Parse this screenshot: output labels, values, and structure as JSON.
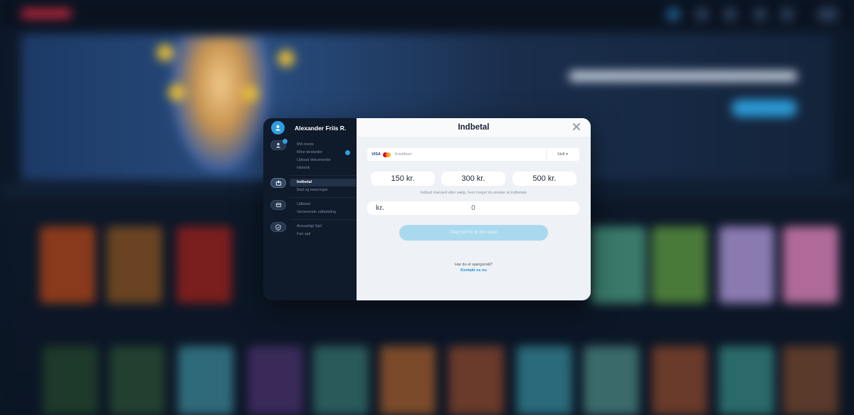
{
  "colors": {
    "accent": "#2d9fe0",
    "sidebar_bg": "#0f1a2b",
    "modal_bg": "#eef1f5",
    "submit_disabled": "#a9d9ef",
    "link": "#1f8fd1"
  },
  "sidebar": {
    "user_name": "Alexander Friis R.",
    "avatar_icon": "user-icon",
    "groups": [
      {
        "icon": "profile-icon",
        "items": [
          {
            "label": "Min konto"
          },
          {
            "label": "Mine beskeder",
            "badge": true
          },
          {
            "label": "Upload dokumenter"
          },
          {
            "label": "Historik"
          }
        ]
      },
      {
        "icon": "deposit-icon",
        "items": [
          {
            "label": "Indbetal",
            "active": true
          },
          {
            "label": "Bad og belønnger"
          }
        ]
      },
      {
        "icon": "withdraw-icon",
        "items": [
          {
            "label": "Udbetal"
          },
          {
            "label": "Verserende udbetaling"
          }
        ]
      },
      {
        "icon": "shield-icon",
        "items": [
          {
            "label": "Ansvarligt Spil"
          },
          {
            "label": "Fair spil"
          }
        ]
      }
    ]
  },
  "main": {
    "title": "Indbetal",
    "payment": {
      "card_brand": "VISA",
      "method_label": "Kreditkort",
      "switch_label": "Skift ▾"
    },
    "amounts": [
      "150 kr.",
      "300 kr.",
      "500 kr."
    ],
    "hint": "Indtast manuelt eller vælg, hvor meget du ønsker at indbetale",
    "currency": "kr.",
    "amount_value": "0",
    "submit_label": "Tilføj 0,00 kr. til min konto",
    "question": "Har du et spørgsmål?",
    "contact_link": "Kontakt os nu"
  }
}
